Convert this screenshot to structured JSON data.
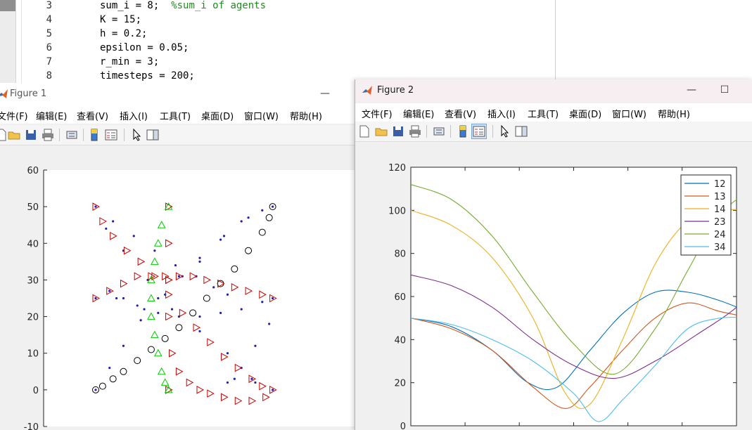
{
  "editor": {
    "lines": [
      {
        "num": "3",
        "code": "sum_i = 8;  ",
        "comment": "%sum_i of agents"
      },
      {
        "num": "4",
        "code": "K = 15;",
        "comment": ""
      },
      {
        "num": "5",
        "code": "h = 0.2;",
        "comment": ""
      },
      {
        "num": "6",
        "code": "epsilon = 0.05;",
        "comment": ""
      },
      {
        "num": "7",
        "code": "r_min = 3;",
        "comment": ""
      },
      {
        "num": "8",
        "code": "timesteps = 200;",
        "comment": ""
      }
    ]
  },
  "figure1": {
    "title": "Figure 1",
    "menu": [
      "文件(F)",
      "编辑(E)",
      "查看(V)",
      "插入(I)",
      "工具(T)",
      "桌面(D)",
      "窗口(W)",
      "帮助(H)"
    ],
    "toolbar_icons": [
      "new-icon",
      "open-icon",
      "save-icon",
      "print-icon",
      "link-icon",
      "colorbar-icon",
      "legend-icon",
      "pointer-icon",
      "property-editor-icon"
    ],
    "min_glyph": "—"
  },
  "figure2": {
    "title": "Figure 2",
    "menu": [
      "文件(F)",
      "编辑(E)",
      "查看(V)",
      "插入(I)",
      "工具(T)",
      "桌面(D)",
      "窗口(W)",
      "帮助(H)"
    ],
    "toolbar_icons": [
      "new-icon",
      "open-icon",
      "save-icon",
      "print-icon",
      "link-icon",
      "colorbar-icon",
      "legend-icon",
      "pointer-icon",
      "property-editor-icon"
    ],
    "min_glyph": "—",
    "max_glyph": "☐"
  },
  "chart_data": [
    {
      "type": "scatter",
      "title": "",
      "xlabel": "",
      "ylabel": "",
      "xlim": [
        -15,
        75
      ],
      "ylim": [
        -10,
        60
      ],
      "yticks": [
        -10,
        0,
        10,
        20,
        30,
        40,
        50,
        60
      ],
      "grid": false,
      "series": [
        {
          "marker": "circle",
          "color": "#000000",
          "values": [
            [
              0,
              0
            ],
            [
              2,
              1
            ],
            [
              5,
              3
            ],
            [
              8,
              5
            ],
            [
              12,
              8
            ],
            [
              16,
              11
            ],
            [
              20,
              14
            ],
            [
              24,
              17
            ],
            [
              28,
              21
            ],
            [
              32,
              25
            ],
            [
              36,
              29
            ],
            [
              40,
              33
            ],
            [
              44,
              38
            ],
            [
              48,
              43
            ],
            [
              50,
              47
            ],
            [
              51,
              50
            ]
          ]
        },
        {
          "marker": "dot",
          "color": "#1f1fb0",
          "values": [
            [
              0,
              0
            ],
            [
              4,
              6
            ],
            [
              8,
              12
            ],
            [
              13,
              19
            ],
            [
              18,
              25
            ],
            [
              24,
              31
            ],
            [
              30,
              36
            ],
            [
              36,
              41
            ],
            [
              42,
              46
            ],
            [
              48,
              49
            ],
            [
              51,
              50
            ],
            [
              44,
              47
            ],
            [
              37,
              42
            ],
            [
              30,
              35
            ],
            [
              25,
              31
            ],
            [
              20,
              26
            ],
            [
              14,
              22
            ],
            [
              8,
              25
            ],
            [
              4,
              27
            ],
            [
              0,
              25
            ],
            [
              6,
              25
            ],
            [
              12,
              23
            ],
            [
              18,
              21
            ],
            [
              24,
              20
            ],
            [
              30,
              20
            ],
            [
              36,
              21
            ],
            [
              42,
              22
            ],
            [
              48,
              24
            ],
            [
              51,
              25
            ],
            [
              50,
              18
            ],
            [
              46,
              12
            ],
            [
              42,
              6
            ],
            [
              38,
              2
            ],
            [
              40,
              3
            ],
            [
              46,
              2
            ],
            [
              51,
              0
            ],
            [
              45,
              3
            ],
            [
              38,
              10
            ],
            [
              30,
              16
            ],
            [
              22,
              22
            ],
            [
              15,
              30
            ],
            [
              8,
              38
            ],
            [
              3,
              44
            ],
            [
              0,
              50
            ],
            [
              5,
              46
            ],
            [
              11,
              42
            ],
            [
              17,
              38
            ],
            [
              23,
              34
            ],
            [
              29,
              31
            ],
            [
              34,
              28
            ],
            [
              38,
              26
            ]
          ]
        },
        {
          "marker": "triangle-right",
          "color": "#cc0000",
          "values": [
            [
              0,
              50
            ],
            [
              2,
              46
            ],
            [
              5,
              42
            ],
            [
              9,
              38
            ],
            [
              13,
              35
            ],
            [
              17,
              31
            ],
            [
              21,
              26
            ],
            [
              25,
              21
            ],
            [
              29,
              17
            ],
            [
              33,
              13
            ],
            [
              37,
              9
            ],
            [
              41,
              6
            ],
            [
              45,
              3
            ],
            [
              48,
              1
            ],
            [
              51,
              0
            ],
            [
              49,
              -2
            ],
            [
              45,
              -3
            ],
            [
              41,
              -3
            ],
            [
              37,
              -2
            ],
            [
              33,
              -1
            ],
            [
              30,
              0
            ],
            [
              27,
              2
            ],
            [
              24,
              5
            ],
            [
              22,
              10
            ],
            [
              21,
              20
            ],
            [
              21,
              30
            ],
            [
              21,
              40
            ],
            [
              21,
              50
            ],
            [
              21,
              30
            ],
            [
              21,
              0
            ],
            [
              0,
              25
            ],
            [
              4,
              27
            ],
            [
              8,
              29
            ],
            [
              12,
              31
            ],
            [
              16,
              31
            ],
            [
              20,
              31
            ],
            [
              24,
              31
            ],
            [
              28,
              31
            ],
            [
              32,
              30
            ],
            [
              36,
              29
            ],
            [
              40,
              28
            ],
            [
              44,
              27
            ],
            [
              48,
              26
            ],
            [
              51,
              25
            ]
          ]
        },
        {
          "marker": "triangle-up",
          "color": "#00cc00",
          "values": [
            [
              21,
              50
            ],
            [
              19,
              45
            ],
            [
              18,
              40
            ],
            [
              17,
              35
            ],
            [
              16,
              30
            ],
            [
              16,
              25
            ],
            [
              16,
              20
            ],
            [
              17,
              15
            ],
            [
              18,
              10
            ],
            [
              19,
              5
            ],
            [
              20,
              2
            ],
            [
              21,
              0
            ]
          ]
        }
      ]
    },
    {
      "type": "line",
      "title": "",
      "xlabel": "",
      "ylabel": "",
      "ylim": [
        0,
        120
      ],
      "yticks": [
        0,
        20,
        40,
        60,
        80,
        100,
        120
      ],
      "xlim": [
        0,
        200
      ],
      "grid": false,
      "legend": "top-right",
      "series": [
        {
          "name": "12",
          "color": "#0072bd",
          "x": [
            0,
            25,
            50,
            72,
            90,
            110,
            130,
            150,
            170,
            190,
            210
          ],
          "values": [
            50,
            46,
            35,
            20,
            18,
            35,
            52,
            62,
            62,
            58,
            52
          ]
        },
        {
          "name": "13",
          "color": "#d95319",
          "x": [
            0,
            25,
            50,
            75,
            95,
            110,
            130,
            150,
            170,
            190,
            210
          ],
          "values": [
            50,
            45,
            35,
            18,
            8,
            18,
            35,
            50,
            57,
            53,
            50
          ]
        },
        {
          "name": "14",
          "color": "#edb120",
          "x": [
            0,
            25,
            50,
            75,
            95,
            110,
            130,
            150,
            170,
            190,
            210
          ],
          "values": [
            100,
            93,
            78,
            50,
            15,
            10,
            40,
            75,
            95,
            100,
            100
          ]
        },
        {
          "name": "23",
          "color": "#7e2f8e",
          "x": [
            0,
            25,
            50,
            75,
            100,
            125,
            150,
            175,
            200,
            220
          ],
          "values": [
            70,
            65,
            55,
            40,
            28,
            22,
            30,
            42,
            55,
            71
          ]
        },
        {
          "name": "24",
          "color": "#77ac30",
          "x": [
            0,
            25,
            50,
            75,
            100,
            125,
            150,
            170,
            190,
            210
          ],
          "values": [
            112,
            105,
            88,
            62,
            38,
            24,
            45,
            72,
            98,
            110
          ]
        },
        {
          "name": "34",
          "color": "#4dbeee",
          "x": [
            0,
            25,
            50,
            75,
            100,
            115,
            130,
            150,
            170,
            190,
            210
          ],
          "values": [
            50,
            47,
            40,
            30,
            15,
            2,
            12,
            28,
            45,
            50,
            50
          ]
        }
      ]
    }
  ]
}
